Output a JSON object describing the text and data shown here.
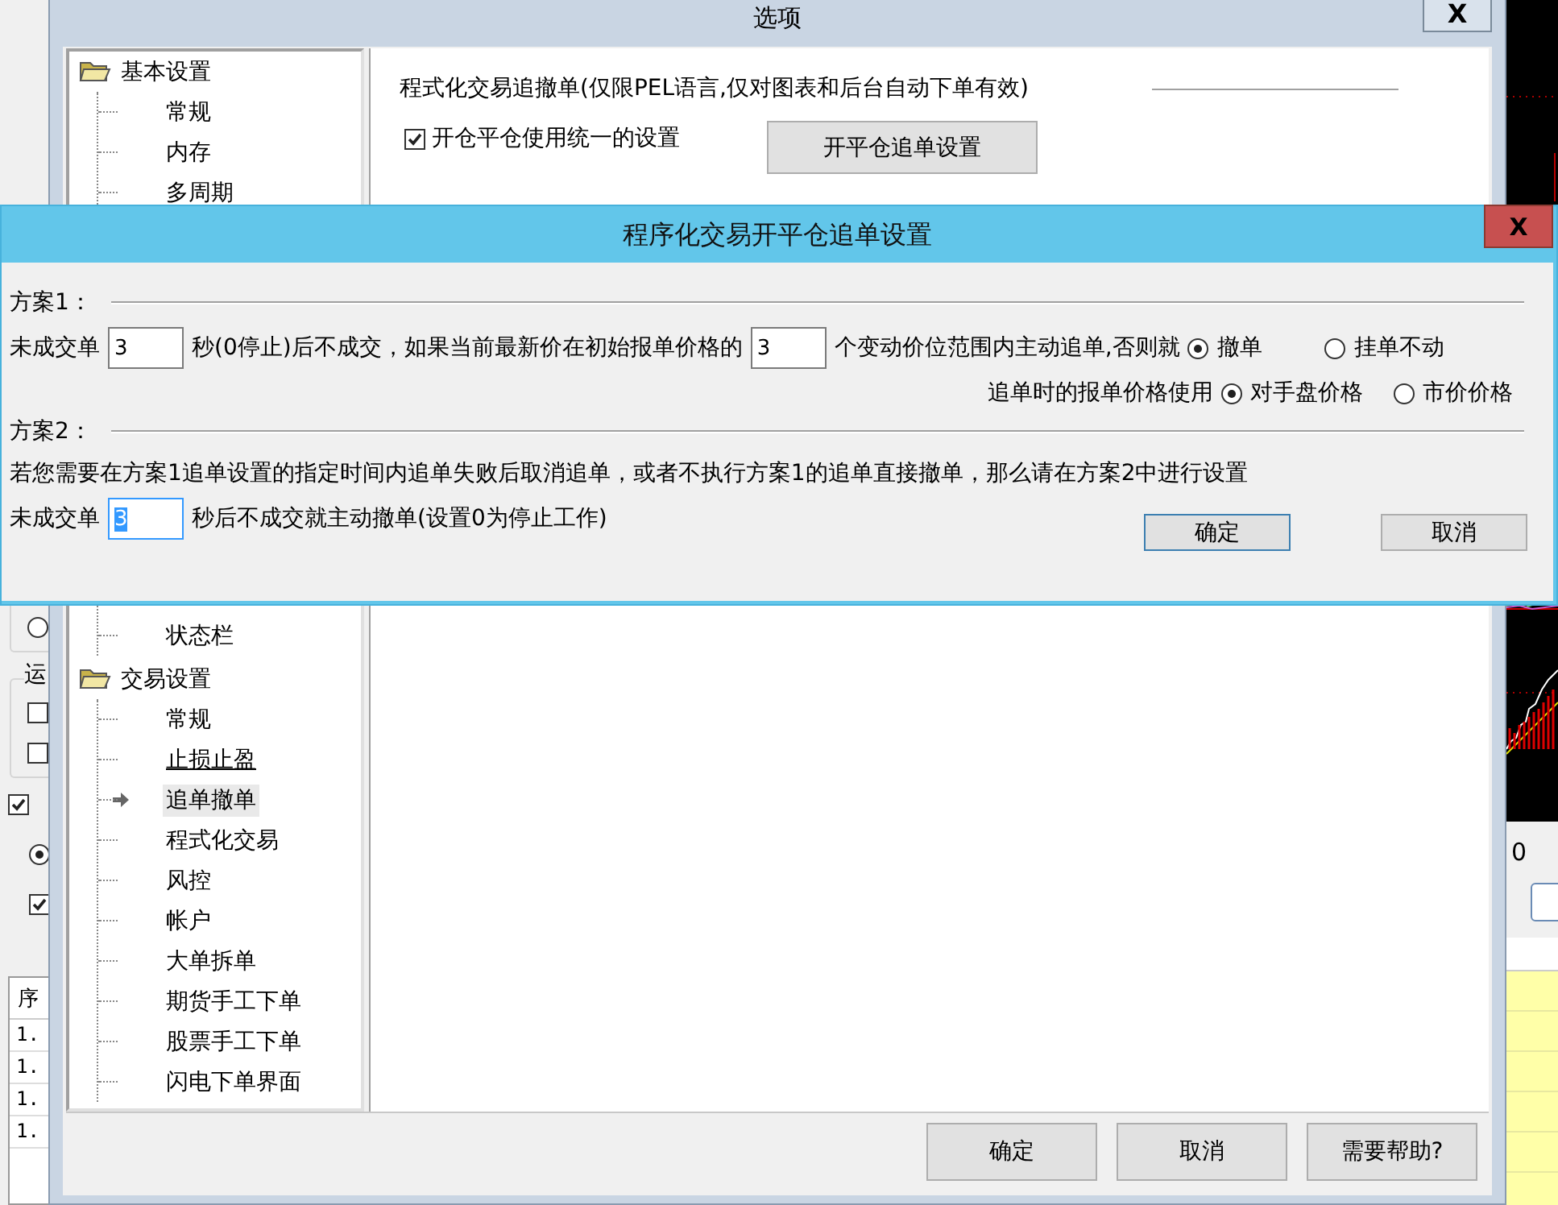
{
  "background_app": {
    "left_panel": {
      "controls": [
        {
          "kind": "radio",
          "checked": false
        },
        {
          "kind": "checkbox",
          "checked": false
        },
        {
          "kind": "checkbox",
          "checked": false
        },
        {
          "kind": "checkbox",
          "checked": true
        },
        {
          "kind": "radio",
          "checked": true
        },
        {
          "kind": "checkbox",
          "checked": true
        }
      ],
      "group_label": "运",
      "table": {
        "header": "序",
        "rows": [
          "1.",
          "1.",
          "1.",
          "1."
        ]
      }
    },
    "right_panel": {
      "value": "0"
    }
  },
  "options_window": {
    "title": "选项",
    "close": "X",
    "tree": [
      {
        "label": "基本设置",
        "expanded": true,
        "children": [
          {
            "label": "常规",
            "selected": false,
            "hovered": false
          },
          {
            "label": "内存",
            "selected": false,
            "hovered": false
          },
          {
            "label": "多周期",
            "selected": false,
            "hovered": false
          },
          {
            "label": "状态栏",
            "selected": false,
            "hovered": false
          }
        ]
      },
      {
        "label": "交易设置",
        "expanded": true,
        "children": [
          {
            "label": "常规",
            "selected": false,
            "hovered": false
          },
          {
            "label": "止损止盈",
            "selected": false,
            "hovered": true
          },
          {
            "label": "追单撤单",
            "selected": true,
            "hovered": false
          },
          {
            "label": "程式化交易",
            "selected": false,
            "hovered": false
          },
          {
            "label": "风控",
            "selected": false,
            "hovered": false
          },
          {
            "label": "帐户",
            "selected": false,
            "hovered": false
          },
          {
            "label": "大单拆单",
            "selected": false,
            "hovered": false
          },
          {
            "label": "期货手工下单",
            "selected": false,
            "hovered": false
          },
          {
            "label": "股票手工下单",
            "selected": false,
            "hovered": false
          },
          {
            "label": "闪电下单界面",
            "selected": false,
            "hovered": false
          }
        ]
      }
    ],
    "content": {
      "heading": "程式化交易追撤单(仅限PEL语言,仅对图表和后台自动下单有效)",
      "unified_checkbox": {
        "label": "开仓平仓使用统一的设置",
        "checked": true
      },
      "settings_button": "开平仓追单设置"
    },
    "buttons": [
      "确定",
      "取消",
      "需要帮助?"
    ]
  },
  "chase_dialog": {
    "title": "程序化交易开平仓追单设置",
    "close": "X",
    "plan1": {
      "label": "方案1：",
      "text_before": "未成交单",
      "seconds_field": {
        "value": "3",
        "focused": false
      },
      "text_middle": "秒(0停止)后不成交，如果当前最新价在初始报单价格的",
      "ticks_field": {
        "value": "3",
        "focused": false
      },
      "text_after": "个变动价位范围内主动追单,否则就",
      "otherwise_options": [
        {
          "label": "撤单",
          "selected": true
        },
        {
          "label": "挂单不动",
          "selected": false
        }
      ],
      "price_label": "追单时的报单价格使用",
      "price_options": [
        {
          "label": "对手盘价格",
          "selected": true
        },
        {
          "label": "市价价格",
          "selected": false
        }
      ]
    },
    "plan2": {
      "label": "方案2：",
      "description": "若您需要在方案1追单设置的指定时间内追单失败后取消追单，或者不执行方案1的追单直接撤单，那么请在方案2中进行设置",
      "text_before": "未成交单",
      "seconds_field": {
        "value": "3",
        "focused": true
      },
      "text_after": "秒后不成交就主动撤单(设置0为停止工作)"
    },
    "buttons": [
      {
        "label": "确定",
        "default": true
      },
      {
        "label": "取消",
        "default": false
      }
    ]
  }
}
